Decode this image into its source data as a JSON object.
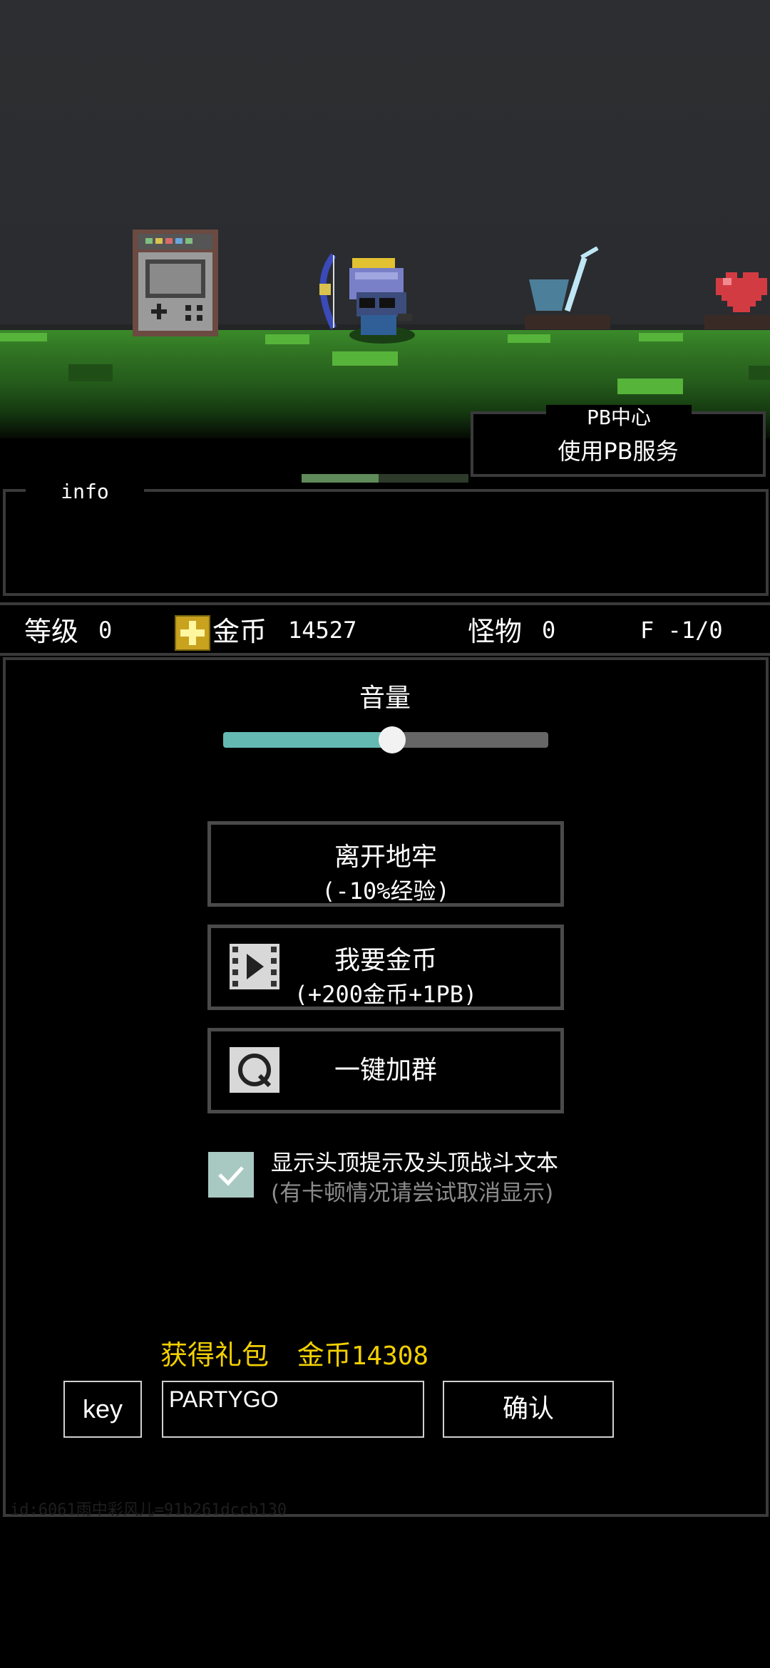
{
  "pb_center": {
    "title": "PB中心",
    "subtitle": "使用PB服务"
  },
  "progress": {
    "fraction": 0.46
  },
  "info": {
    "title": "info"
  },
  "stats": {
    "level_label": "等级",
    "level_value": "0",
    "gold_label": "金币",
    "gold_value": "14527",
    "monster_label": "怪物",
    "monster_value": "0",
    "floor": "F -1/0"
  },
  "volume": {
    "label": "音量",
    "fraction": 0.52
  },
  "buttons": {
    "leave": {
      "line1": "离开地牢",
      "line2": "(-10%经验)"
    },
    "gold": {
      "line1": "我要金币",
      "line2": "(+200金币+1PB)"
    },
    "group": {
      "label": "一键加群"
    }
  },
  "checkbox": {
    "checked": true,
    "line1": "显示头顶提示及头顶战斗文本",
    "line2": "(有卡顿情况请尝试取消显示)"
  },
  "gift": {
    "label": "获得礼包",
    "coin_label": "金币",
    "coin_value": "14308"
  },
  "redeem": {
    "key_label": "key",
    "input_value": "PARTYGO",
    "confirm_label": "确认"
  },
  "footer": {
    "text": "id:6061雨中彩风儿=91b261dccb130"
  },
  "colors": {
    "accent": "#64b9b3",
    "gold_text": "#f2d000",
    "border": "#3a3a3a"
  }
}
